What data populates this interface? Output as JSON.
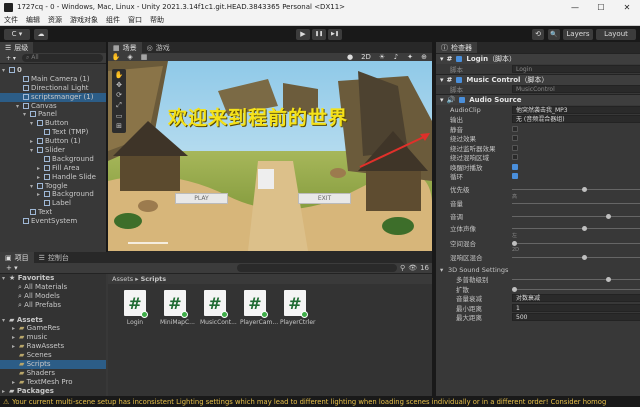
{
  "window": {
    "title": "1727cq - 0 - Windows, Mac, Linux - Unity 2021.3.14f1c1.git.HEAD.3843365 Personal <DX11>",
    "min": "—",
    "max": "☐",
    "close": "✕"
  },
  "menu": [
    "文件",
    "编辑",
    "资源",
    "游戏对象",
    "组件",
    "窗口",
    "帮助"
  ],
  "toolbar": {
    "account": "C ▾",
    "cloud": "☁",
    "play": "▶",
    "pause": "❚❚",
    "step": "▶❚",
    "layers": "Layers",
    "layout": "Layout",
    "history": "⟲",
    "search": "🔍"
  },
  "hierarchy": {
    "tab": "层级",
    "search_placeholder": "All",
    "add": "+ ▾",
    "rows": [
      {
        "label": "0",
        "indent": 0,
        "arrow": "▾",
        "selected": false,
        "bold": true
      },
      {
        "label": "Main Camera (1)",
        "indent": 2,
        "arrow": "",
        "selected": false
      },
      {
        "label": "Directional Light",
        "indent": 2,
        "arrow": "",
        "selected": false
      },
      {
        "label": "scriptsmanger (1)",
        "indent": 2,
        "arrow": "",
        "selected": true
      },
      {
        "label": "Canvas",
        "indent": 2,
        "arrow": "▾",
        "selected": false
      },
      {
        "label": "Panel",
        "indent": 3,
        "arrow": "▾",
        "selected": false
      },
      {
        "label": "Button",
        "indent": 4,
        "arrow": "▾",
        "selected": false
      },
      {
        "label": "Text (TMP)",
        "indent": 5,
        "arrow": "",
        "selected": false
      },
      {
        "label": "Button (1)",
        "indent": 4,
        "arrow": "▸",
        "selected": false
      },
      {
        "label": "Slider",
        "indent": 4,
        "arrow": "▾",
        "selected": false
      },
      {
        "label": "Background",
        "indent": 5,
        "arrow": "",
        "selected": false
      },
      {
        "label": "Fill Area",
        "indent": 5,
        "arrow": "▸",
        "selected": false
      },
      {
        "label": "Handle Slide",
        "indent": 5,
        "arrow": "▸",
        "selected": false
      },
      {
        "label": "Toggle",
        "indent": 4,
        "arrow": "▾",
        "selected": false
      },
      {
        "label": "Background",
        "indent": 5,
        "arrow": "▸",
        "selected": false
      },
      {
        "label": "Label",
        "indent": 5,
        "arrow": "",
        "selected": false
      },
      {
        "label": "Text",
        "indent": 3,
        "arrow": "",
        "selected": false
      },
      {
        "label": "EventSystem",
        "indent": 2,
        "arrow": "",
        "selected": false
      }
    ]
  },
  "scene": {
    "tab_scene": "场景",
    "tab_game": "游戏",
    "mode_2d": "2D",
    "title_text": "欢迎来到程前的世界",
    "play_btn": "PLAY",
    "exit_btn": "EXIT"
  },
  "project": {
    "tab_project": "项目",
    "tab_console": "控制台",
    "breadcrumb": [
      "Assets",
      "Scripts"
    ],
    "count": "16",
    "favorites_label": "Favorites",
    "favorites": [
      "All Materials",
      "All Models",
      "All Prefabs"
    ],
    "assets_label": "Assets",
    "assets": [
      "GameRes",
      "music",
      "RawAssets",
      "Scenes",
      "Scripts",
      "Shaders",
      "TextMesh Pro"
    ],
    "packages_label": "Packages",
    "files": [
      "Login",
      "MiniMapC...",
      "MusicCont...",
      "PlayerCam...",
      "PlayerCtrler"
    ]
  },
  "inspector": {
    "tab": "检查器",
    "comp1": {
      "name": "Login",
      "suffix": "（脚本）",
      "script_label": "脚本",
      "script_value": "Login"
    },
    "comp2": {
      "name": "Music Control",
      "suffix": "（脚本）",
      "script_label": "脚本",
      "script_value": "MusicControl"
    },
    "audio": {
      "name": "Audio Source",
      "clip_label": "AudioClip",
      "clip_value": "他突然袭击我_MP3",
      "output_label": "输出",
      "output_value": "无 (音频混合器组)",
      "mute": "静音",
      "bypass_effects": "绕过效果",
      "bypass_listener": "绕过监听器效果",
      "bypass_reverb": "绕过混响区域",
      "play_awake": "唤醒时播放",
      "loop": "循环",
      "priority_label": "优先级",
      "priority_value": "128",
      "priority_low": "高",
      "priority_high": "低",
      "volume_label": "音量",
      "volume_value": "1",
      "pitch_label": "音调",
      "pitch_value": "1",
      "stereo_label": "立体声像",
      "stereo_value": "0",
      "stereo_l": "左",
      "stereo_r": "右",
      "spatial_label": "空间混合",
      "spatial_value": "0",
      "spatial_2d": "2D",
      "spatial_3d": "3D",
      "reverb_label": "混响区混合",
      "reverb_value": "1",
      "sound3d_label": "3D Sound Settings",
      "doppler_label": "多普勒级别",
      "doppler_value": "1",
      "spread_label": "扩散",
      "spread_value": "0",
      "rolloff_label": "音量衰减",
      "rolloff_value": "对数衰减",
      "min_label": "最小距离",
      "min_value": "1",
      "max_label": "最大距离",
      "max_value": "500"
    }
  },
  "status": "Your current multi-scene setup has inconsistent Lighting settings which may lead to different lighting when loading scenes individually or in a different order! Consider homog"
}
